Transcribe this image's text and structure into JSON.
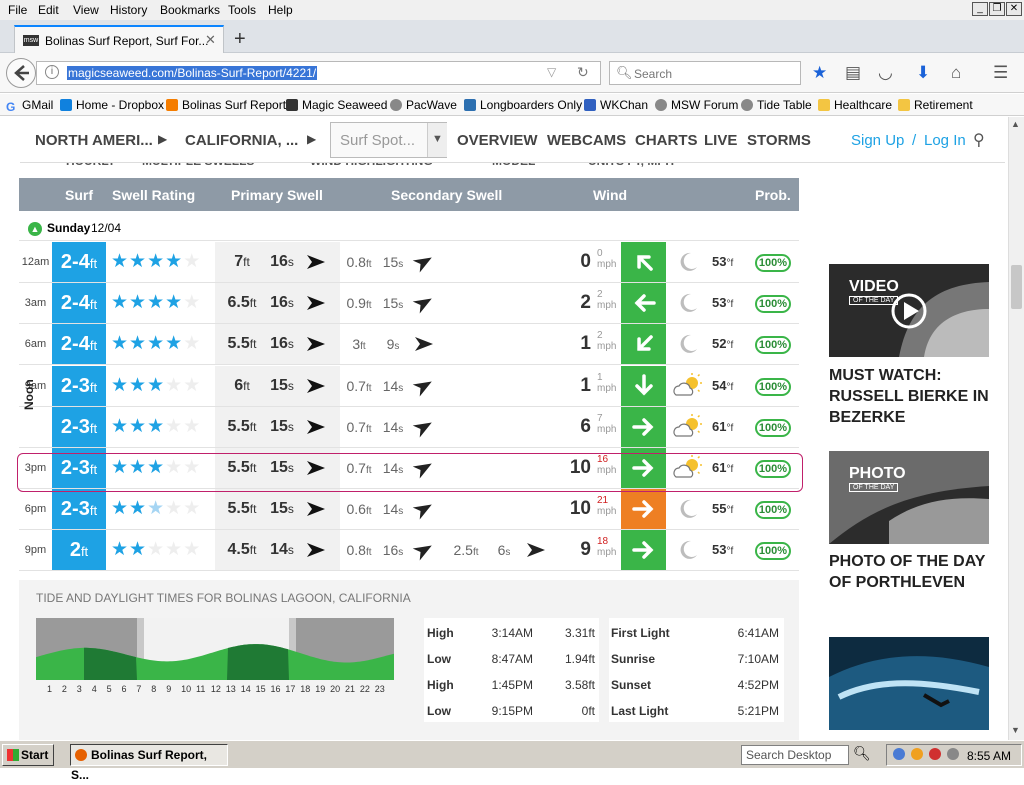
{
  "menu": [
    "File",
    "Edit",
    "View",
    "History",
    "Bookmarks",
    "Tools",
    "Help"
  ],
  "tab": {
    "title": "Bolinas Surf Report, Surf For..."
  },
  "url": "magicseaweed.com/Bolinas-Surf-Report/4221/",
  "search_placeholder": "Search",
  "bookmarks": [
    "GMail",
    "Home - Dropbox",
    "Bolinas Surf Report",
    "Magic Seaweed",
    "PacWave",
    "Longboarders Only",
    "WKChan",
    "MSW Forum",
    "Tide Table",
    "Healthcare",
    "Retirement"
  ],
  "sitenav": {
    "region1": "NORTH AMERI...",
    "region2": "CALIFORNIA, ...",
    "spot_placeholder": "Surf Spot...",
    "links": [
      "OVERVIEW",
      "WEBCAMS",
      "CHARTS",
      "LIVE",
      "STORMS"
    ],
    "signup": "Sign Up",
    "sep": "/",
    "login": "Log In"
  },
  "hidden_controls": [
    "HOURLY",
    "MULTIPLE SWELLS",
    "WIND HIGHLIGHTING",
    "MODEL",
    "UNITS FT, MPH"
  ],
  "table": {
    "headers": {
      "surf": "Surf",
      "swell": "Swell Rating",
      "primary": "Primary Swell",
      "secondary": "Secondary Swell",
      "wind": "Wind",
      "prob": "Prob."
    },
    "day": "Sunday",
    "date": "12/04",
    "noon": "Noon",
    "rows": [
      {
        "time": "12am",
        "surf": "2-4",
        "stars": 4,
        "half": false,
        "ph": "7",
        "pp": "16",
        "sh": "0.8",
        "sp": "15",
        "ws": "0",
        "wg": "0",
        "wdir": "nw",
        "wcolor": "g",
        "icon": "moon",
        "tmp": "53",
        "prob": "100%"
      },
      {
        "time": "3am",
        "surf": "2-4",
        "stars": 4,
        "half": false,
        "ph": "6.5",
        "pp": "16",
        "sh": "0.9",
        "sp": "15",
        "ws": "2",
        "wg": "2",
        "wdir": "w",
        "wcolor": "g",
        "icon": "moon",
        "tmp": "53",
        "prob": "100%"
      },
      {
        "time": "6am",
        "surf": "2-4",
        "stars": 4,
        "half": false,
        "ph": "5.5",
        "pp": "16",
        "sh": "3",
        "sp": "9",
        "ws": "1",
        "wg": "2",
        "wdir": "sw",
        "wcolor": "g",
        "icon": "moon",
        "tmp": "52",
        "prob": "100%"
      },
      {
        "time": "9am",
        "surf": "2-3",
        "stars": 3,
        "half": false,
        "ph": "6",
        "pp": "15",
        "sh": "0.7",
        "sp": "14",
        "ws": "1",
        "wg": "1",
        "wdir": "s",
        "wcolor": "g",
        "icon": "sun",
        "tmp": "54",
        "prob": "100%"
      },
      {
        "time": "",
        "surf": "2-3",
        "stars": 3,
        "half": false,
        "ph": "5.5",
        "pp": "15",
        "sh": "0.7",
        "sp": "14",
        "ws": "6",
        "wg": "7",
        "wdir": "e",
        "wcolor": "g",
        "icon": "sun",
        "tmp": "61",
        "prob": "100%"
      },
      {
        "time": "3pm",
        "surf": "2-3",
        "stars": 3,
        "half": false,
        "ph": "5.5",
        "pp": "15",
        "sh": "0.7",
        "sp": "14",
        "ws": "10",
        "wg": "16",
        "wdir": "e",
        "wcolor": "g",
        "icon": "sun",
        "tmp": "61",
        "prob": "100%"
      },
      {
        "time": "6pm",
        "surf": "2-3",
        "stars": 2,
        "half": true,
        "ph": "5.5",
        "pp": "15",
        "sh": "0.6",
        "sp": "14",
        "ws": "10",
        "wg": "21",
        "wdir": "e",
        "wcolor": "o",
        "icon": "moon",
        "tmp": "55",
        "prob": "100%"
      },
      {
        "time": "9pm",
        "surf": "2",
        "stars": 2,
        "half": false,
        "ph": "4.5",
        "pp": "14",
        "sh": "0.8",
        "sp": "16",
        "sh2": "2.5",
        "sp2": "6",
        "ws": "9",
        "wg": "18",
        "wdir": "e",
        "wcolor": "g",
        "icon": "moon",
        "tmp": "53",
        "prob": "100%"
      }
    ],
    "units": {
      "ft": "ft",
      "s": "s",
      "mph": "mph",
      "f": "°f"
    }
  },
  "tide": {
    "title": "TIDE AND DAYLIGHT TIMES FOR BOLINAS LAGOON, CALIFORNIA",
    "hours": [
      "1",
      "2",
      "3",
      "4",
      "5",
      "6",
      "7",
      "8",
      "9",
      "10",
      "11",
      "12",
      "13",
      "14",
      "15",
      "16",
      "17",
      "18",
      "19",
      "20",
      "21",
      "22",
      "23"
    ],
    "tides": [
      {
        "label": "High",
        "time": "3:14AM",
        "height": "3.31ft"
      },
      {
        "label": "Low",
        "time": "8:47AM",
        "height": "1.94ft"
      },
      {
        "label": "High",
        "time": "1:45PM",
        "height": "3.58ft"
      },
      {
        "label": "Low",
        "time": "9:15PM",
        "height": "0ft"
      }
    ],
    "daylight": [
      {
        "label": "First Light",
        "time": "6:41AM"
      },
      {
        "label": "Sunrise",
        "time": "7:10AM"
      },
      {
        "label": "Sunset",
        "time": "4:52PM"
      },
      {
        "label": "Last Light",
        "time": "5:21PM"
      }
    ]
  },
  "side": {
    "video_badge": "VIDEO",
    "video_sub": "OF THE DAY",
    "video_title": "MUST WATCH: RUSSELL BIERKE IN BEZERKE",
    "photo_badge": "PHOTO",
    "photo_sub": "OF THE DAY",
    "photo_title": "PHOTO OF THE DAY OF PORTHLEVEN"
  },
  "taskbar": {
    "start": "Start",
    "task": "Bolinas Surf Report, S...",
    "search": "Search Desktop",
    "clock": "8:55 AM"
  }
}
